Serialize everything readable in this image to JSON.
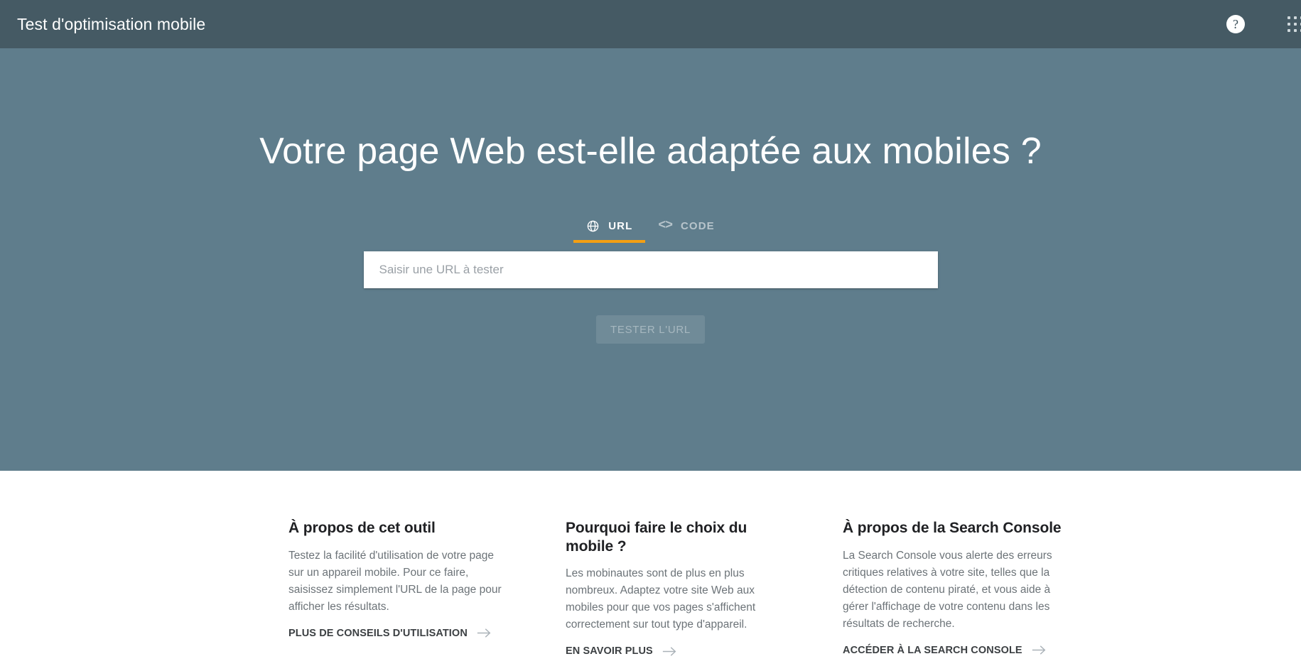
{
  "appbar": {
    "title": "Test d'optimisation mobile",
    "help_icon": "help-circle-icon",
    "help_glyph": "?",
    "apps_icon": "apps-grid-icon"
  },
  "hero": {
    "title": "Votre page Web est-elle adaptée aux mobiles ?",
    "background_color": "#5f7d8c",
    "accent_color": "#f59f12",
    "tabs": [
      {
        "id": "url",
        "label": "URL",
        "icon": "globe-icon",
        "active": true
      },
      {
        "id": "code",
        "label": "CODE",
        "icon": "code-brackets-icon",
        "active": false
      }
    ],
    "url_field": {
      "placeholder": "Saisir une URL à tester",
      "value": ""
    },
    "submit_button": {
      "label": "TESTER L'URL",
      "disabled": true
    }
  },
  "info": {
    "columns": [
      {
        "heading": "À propos de cet outil",
        "body": "Testez la facilité d'utilisation de votre page sur un appareil mobile. Pour ce faire, saisissez simplement l'URL de la page pour afficher les résultats.",
        "link_label": "PLUS DE CONSEILS D'UTILISATION",
        "link_icon": "arrow-right-icon"
      },
      {
        "heading": "Pourquoi faire le choix du mobile ?",
        "body": "Les mobinautes sont de plus en plus nombreux. Adaptez votre site Web aux mobiles pour que vos pages s'affichent correctement sur tout type d'appareil.",
        "link_label": "EN SAVOIR PLUS",
        "link_icon": "arrow-right-icon"
      },
      {
        "heading": "À propos de la Search Console",
        "body": "La Search Console vous alerte des erreurs critiques relatives à votre site, telles que la détection de contenu piraté, et vous aide à gérer l'affichage de votre contenu dans les résultats de recherche.",
        "link_label": "ACCÉDER À LA SEARCH CONSOLE",
        "link_icon": "arrow-right-icon"
      }
    ]
  }
}
